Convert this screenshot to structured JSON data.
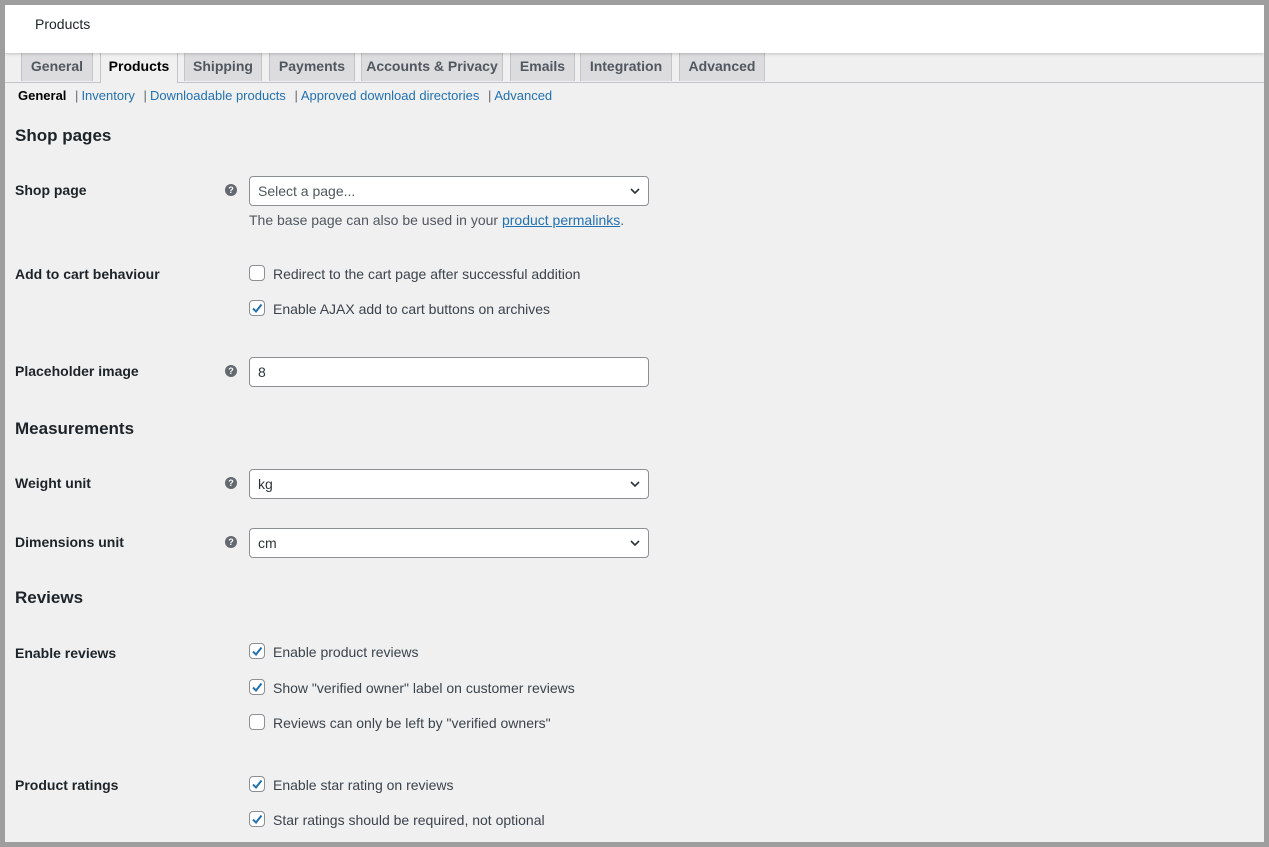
{
  "page": {
    "title": "Products"
  },
  "tabs": [
    {
      "label": "General"
    },
    {
      "label": "Products"
    },
    {
      "label": "Shipping"
    },
    {
      "label": "Payments"
    },
    {
      "label": "Accounts & Privacy"
    },
    {
      "label": "Emails"
    },
    {
      "label": "Integration"
    },
    {
      "label": "Advanced"
    }
  ],
  "subnav": {
    "current": "General",
    "links": [
      "Inventory",
      "Downloadable products",
      "Approved download directories",
      "Advanced"
    ],
    "separator": "|"
  },
  "sections": {
    "shop_pages": "Shop pages",
    "measurements": "Measurements",
    "reviews": "Reviews"
  },
  "shop_page": {
    "label": "Shop page",
    "placeholder": "Select a page...",
    "desc_prefix": "The base page can also be used in your ",
    "desc_link": "product permalinks",
    "desc_suffix": "."
  },
  "add_to_cart": {
    "label": "Add to cart behaviour",
    "options": [
      {
        "label": "Redirect to the cart page after successful addition",
        "checked": false
      },
      {
        "label": "Enable AJAX add to cart buttons on archives",
        "checked": true
      }
    ]
  },
  "placeholder_image": {
    "label": "Placeholder image",
    "value": "8"
  },
  "weight_unit": {
    "label": "Weight unit",
    "value": "kg"
  },
  "dimensions_unit": {
    "label": "Dimensions unit",
    "value": "cm"
  },
  "enable_reviews": {
    "label": "Enable reviews",
    "options": [
      {
        "label": "Enable product reviews",
        "checked": true
      },
      {
        "label": "Show \"verified owner\" label on customer reviews",
        "checked": true
      },
      {
        "label": "Reviews can only be left by \"verified owners\"",
        "checked": false
      }
    ]
  },
  "product_ratings": {
    "label": "Product ratings",
    "options": [
      {
        "label": "Enable star rating on reviews",
        "checked": true
      },
      {
        "label": "Star ratings should be required, not optional",
        "checked": true
      }
    ]
  },
  "icons": {
    "help": "help-icon",
    "chevron": "chevron-down-icon",
    "check": "checkmark-icon"
  },
  "colors": {
    "accent": "#2271b1",
    "background": "#f0f0f1",
    "text": "#1d2327"
  }
}
